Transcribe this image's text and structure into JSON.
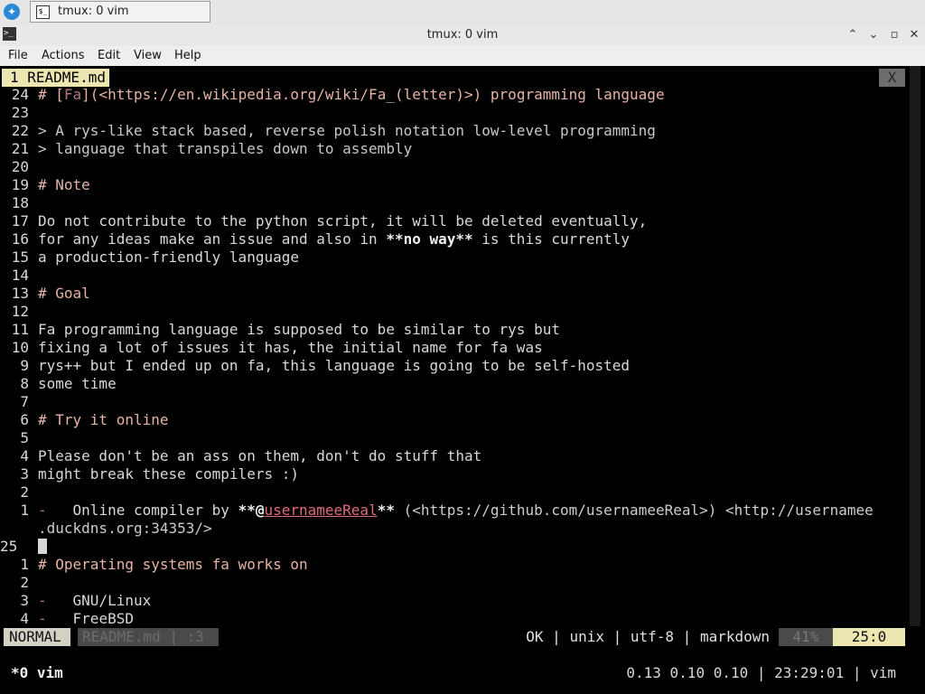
{
  "taskbar": {
    "task_title": "tmux: 0 vim",
    "task_icon": "$_"
  },
  "window": {
    "title": "tmux: 0 vim",
    "icon": ">_"
  },
  "menu": [
    "File",
    "Actions",
    "Edit",
    "View",
    "Help"
  ],
  "vim": {
    "tab": {
      "label": "1 README.md",
      "close": "X"
    },
    "lines": [
      {
        "n": "24",
        "segments": [
          {
            "t": "# [",
            "c": "h"
          },
          {
            "t": "Fa",
            "c": "mk"
          },
          {
            "t": "](<https://en.wikipedia.org/wiki/Fa_(letter)>) programming language",
            "c": "h"
          }
        ]
      },
      {
        "n": "23",
        "segments": []
      },
      {
        "n": "22",
        "segments": [
          {
            "t": "> A rys-like stack based, reverse polish notation low-level programming",
            "c": "q"
          }
        ]
      },
      {
        "n": "21",
        "segments": [
          {
            "t": "> language that transpiles down to assembly",
            "c": "q"
          }
        ]
      },
      {
        "n": "20",
        "segments": []
      },
      {
        "n": "19",
        "segments": [
          {
            "t": "# Note",
            "c": "h"
          }
        ]
      },
      {
        "n": "18",
        "segments": []
      },
      {
        "n": "17",
        "segments": [
          {
            "t": "Do not contribute to the python script, it will be deleted eventually,",
            "c": ""
          }
        ]
      },
      {
        "n": "16",
        "segments": [
          {
            "t": "for any ideas make an issue and also in ",
            "c": ""
          },
          {
            "t": "**no way**",
            "c": "bold"
          },
          {
            "t": " is this currently",
            "c": ""
          }
        ]
      },
      {
        "n": "15",
        "segments": [
          {
            "t": "a production-friendly language",
            "c": ""
          }
        ]
      },
      {
        "n": "14",
        "segments": []
      },
      {
        "n": "13",
        "segments": [
          {
            "t": "# Goal",
            "c": "h"
          }
        ]
      },
      {
        "n": "12",
        "segments": []
      },
      {
        "n": "11",
        "segments": [
          {
            "t": "Fa programming language is supposed to be similar to rys but",
            "c": ""
          }
        ]
      },
      {
        "n": "10",
        "segments": [
          {
            "t": "fixing a lot of issues it has, the initial name for fa was",
            "c": ""
          }
        ]
      },
      {
        "n": "9",
        "segments": [
          {
            "t": "rys++ but I ended up on fa, this language is going to be self-hosted",
            "c": ""
          }
        ]
      },
      {
        "n": "8",
        "segments": [
          {
            "t": "some time",
            "c": ""
          }
        ]
      },
      {
        "n": "7",
        "segments": []
      },
      {
        "n": "6",
        "segments": [
          {
            "t": "# Try it online",
            "c": "h"
          }
        ]
      },
      {
        "n": "5",
        "segments": []
      },
      {
        "n": "4",
        "segments": [
          {
            "t": "Please don't be an ass on them, don't do stuff that",
            "c": ""
          }
        ]
      },
      {
        "n": "3",
        "segments": [
          {
            "t": "might break these compilers :)",
            "c": ""
          }
        ]
      },
      {
        "n": "2",
        "segments": []
      },
      {
        "n": "1",
        "segments": [
          {
            "t": "-",
            "c": "mk"
          },
          {
            "t": "   Online compiler by ",
            "c": ""
          },
          {
            "t": "**@",
            "c": "bold"
          },
          {
            "t": "usernameeReal",
            "c": "ulink"
          },
          {
            "t": "**",
            "c": "bold"
          },
          {
            "t": " (<https://github.com/usernameeReal>) <http://usernamee",
            "c": "url"
          }
        ]
      },
      {
        "n": "",
        "segments": [
          {
            "t": ".duckdns.org:34353/>",
            "c": "url"
          }
        ]
      },
      {
        "n": "25",
        "current": true,
        "segments": []
      },
      {
        "n": "1",
        "segments": [
          {
            "t": "# Operating systems fa works on",
            "c": "h"
          }
        ]
      },
      {
        "n": "2",
        "segments": []
      },
      {
        "n": "3",
        "segments": [
          {
            "t": "-",
            "c": "mk"
          },
          {
            "t": "   GNU/Linux",
            "c": ""
          }
        ]
      },
      {
        "n": "4",
        "segments": [
          {
            "t": "-",
            "c": "mk"
          },
          {
            "t": "   FreeBSD",
            "c": ""
          }
        ]
      }
    ],
    "status": {
      "mode": "NORMAL",
      "file": "README.md  | :3",
      "info": "OK | unix | utf-8 | markdown",
      "percent": "41%",
      "position": "25:0"
    }
  },
  "tmux": {
    "window": "*0 vim",
    "right": "0.13 0.10 0.10 | 23:29:01 | vim"
  },
  "colors": {
    "accent": "#ece6b0",
    "heading": "#e6b3a5",
    "link": "#e06b76",
    "background": "#000000"
  }
}
